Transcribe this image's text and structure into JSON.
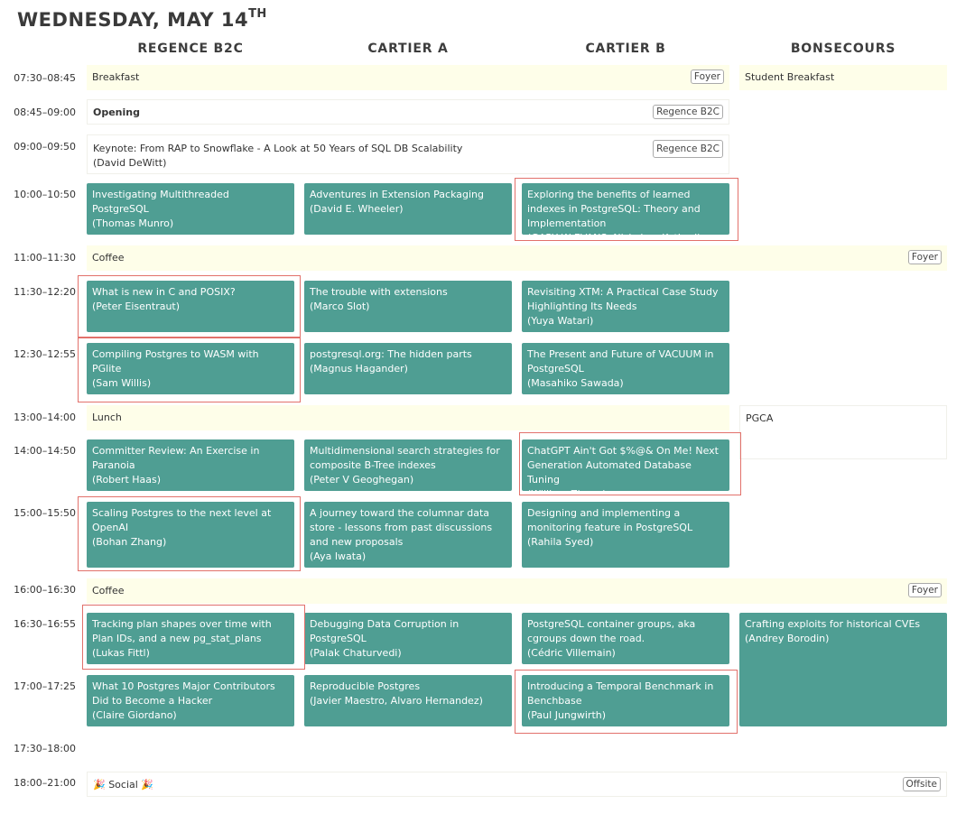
{
  "day": {
    "title": "WEDNESDAY, MAY 14",
    "suffix": "TH"
  },
  "columns": [
    "REGENCE B2C",
    "CARTIER A",
    "CARTIER B",
    "BONSECOURS"
  ],
  "times": {
    "t0730": "07:30–08:45",
    "t0845": "08:45–09:00",
    "t0900": "09:00–09:50",
    "t1000": "10:00–10:50",
    "t1100": "11:00–11:30",
    "t1130": "11:30–12:20",
    "t1230": "12:30–12:55",
    "t1300": "13:00–14:00",
    "t1400": "14:00–14:50",
    "t1500": "15:00–15:50",
    "t1600": "16:00–16:30",
    "t1630": "16:30–16:55",
    "t1700": "17:00–17:25",
    "t1730": "17:30–18:00",
    "t1800": "18:00–21:00"
  },
  "bands": {
    "breakfast": {
      "label": "Breakfast",
      "room": "Foyer"
    },
    "student_breakfast": {
      "label": "Student Breakfast"
    },
    "opening": {
      "label": "Opening",
      "room": "Regence B2C"
    },
    "keynote": {
      "title": "Keynote: From RAP to Snowflake - A Look at 50 Years of SQL DB Scalability",
      "speaker": "(David DeWitt)",
      "room": "Regence B2C"
    },
    "coffee1": {
      "label": "Coffee",
      "room": "Foyer"
    },
    "lunch": {
      "label": "Lunch"
    },
    "pgca": {
      "label": "PGCA"
    },
    "coffee2": {
      "label": "Coffee",
      "room": "Foyer"
    },
    "social": {
      "label": "🎉 Social 🎉",
      "room": "Offsite"
    }
  },
  "talks": {
    "r1000a": {
      "title": "Investigating Multithreaded PostgreSQL",
      "speaker": "(Thomas Munro)"
    },
    "r1000b": {
      "title": "Adventures in Extension Packaging",
      "speaker": "(David E. Wheeler)"
    },
    "r1000c": {
      "title": "Exploring the benefits of learned indexes in PostgreSQL: Theory and Implementation",
      "speaker": "(GARY W EVANS, Nishchay Kothari)"
    },
    "r1130a": {
      "title": "What is new in C and POSIX?",
      "speaker": "(Peter Eisentraut)"
    },
    "r1130b": {
      "title": "The trouble with extensions",
      "speaker": "(Marco Slot)"
    },
    "r1130c": {
      "title": "Revisiting XTM: A Practical Case Study Highlighting Its Needs",
      "speaker": "(Yuya Watari)"
    },
    "r1230a": {
      "title": "Compiling Postgres to WASM with PGlite",
      "speaker": "(Sam Willis)"
    },
    "r1230b": {
      "title": "postgresql.org: The hidden parts",
      "speaker": "(Magnus Hagander)"
    },
    "r1230c": {
      "title": "The Present and Future of VACUUM in PostgreSQL",
      "speaker": "(Masahiko Sawada)"
    },
    "r1400a": {
      "title": "Committer Review: An Exercise in Paranoia",
      "speaker": "(Robert Haas)"
    },
    "r1400b": {
      "title": "Multidimensional search strategies for composite B-Tree indexes",
      "speaker": "(Peter V Geoghegan)"
    },
    "r1400c": {
      "title": "ChatGPT Ain't Got $%@& On Me! Next Generation Automated Database Tuning",
      "speaker": "(William Zhang)"
    },
    "r1500a": {
      "title": "Scaling Postgres to the next level at OpenAI",
      "speaker": "(Bohan Zhang)"
    },
    "r1500b": {
      "title": "A journey toward the columnar data store - lessons from past discussions and new proposals",
      "speaker": "(Aya Iwata)"
    },
    "r1500c": {
      "title": "Designing and implementing a monitoring feature in PostgreSQL",
      "speaker": "(Rahila Syed)"
    },
    "r1630a": {
      "title": "Tracking plan shapes over time with Plan IDs, and a new pg_stat_plans",
      "speaker": "(Lukas Fittl)"
    },
    "r1630b": {
      "title": "Debugging Data Corruption in PostgreSQL",
      "speaker": "(Palak Chaturvedi)"
    },
    "r1630c": {
      "title": "PostgreSQL container groups, aka cgroups down the road.",
      "speaker": "(Cédric Villemain)"
    },
    "r1630d": {
      "title": "Crafting exploits for historical CVEs",
      "speaker": "(Andrey Borodin)"
    },
    "r1700a": {
      "title": "What 10 Postgres Major Contributors Did to Become a Hacker",
      "speaker": "(Claire Giordano)"
    },
    "r1700b": {
      "title": "Reproducible Postgres",
      "speaker": "(Javier Maestro, Alvaro Hernandez)"
    },
    "r1700c": {
      "title": "Introducing a Temporal Benchmark in Benchbase",
      "speaker": "(Paul Jungwirth)"
    }
  },
  "colors": {
    "talk": "#4f9e93",
    "highlight": "#e2716b",
    "band": "#fefee9"
  }
}
